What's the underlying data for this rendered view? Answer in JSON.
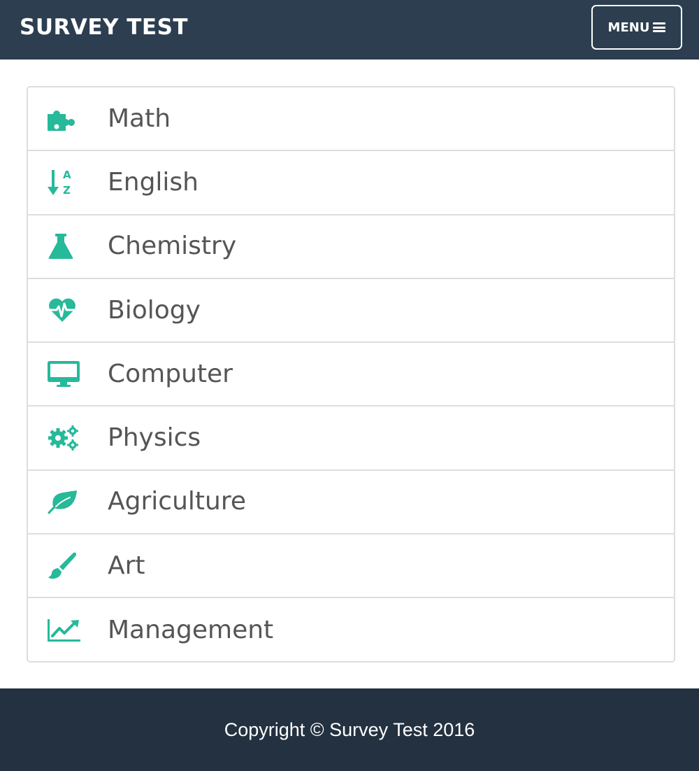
{
  "navbar": {
    "brand": "SURVEY TEST",
    "menu_label": "MENU",
    "menu_icon": "hamburger-icon"
  },
  "subjects": [
    {
      "label": "Math",
      "icon": "puzzle-icon"
    },
    {
      "label": "English",
      "icon": "sort-alpha-down-icon"
    },
    {
      "label": "Chemistry",
      "icon": "flask-icon"
    },
    {
      "label": "Biology",
      "icon": "heartbeat-icon"
    },
    {
      "label": "Computer",
      "icon": "desktop-icon"
    },
    {
      "label": "Physics",
      "icon": "gears-icon"
    },
    {
      "label": "Agriculture",
      "icon": "leaf-icon"
    },
    {
      "label": "Art",
      "icon": "paint-brush-icon"
    },
    {
      "label": "Management",
      "icon": "line-chart-icon"
    }
  ],
  "footer": {
    "copyright": "Copyright © Survey Test 2016"
  },
  "colors": {
    "navbar_bg": "#2c3e50",
    "footer_bg": "#233140",
    "accent": "#26b99a",
    "label_text": "#555555",
    "border": "#dddddd"
  }
}
